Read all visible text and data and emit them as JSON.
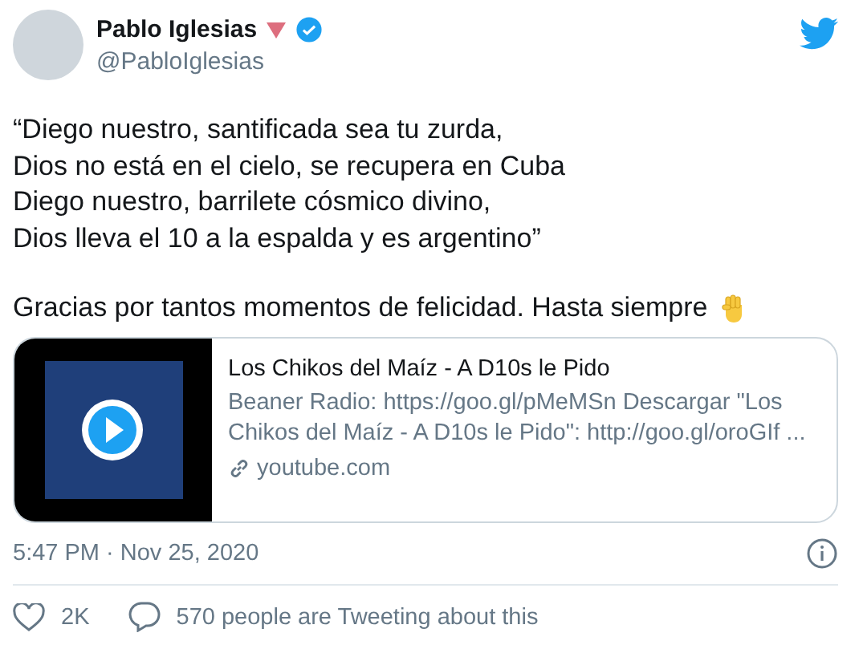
{
  "author": {
    "name": "Pablo Iglesias",
    "handle": "@PabloIglesias",
    "verified": true
  },
  "tweet": {
    "lines": [
      "“Diego nuestro, santificada sea tu zurda,",
      "Dios no está en el cielo, se recupera en Cuba",
      "Diego nuestro, barrilete cósmico divino,",
      "Dios lleva el 10 a la espalda y es argentino”"
    ],
    "closing": "Gracias por tantos momentos de felicidad. Hasta siempre"
  },
  "card": {
    "title": "Los Chikos del Maíz - A D10s le Pido",
    "description": "Beaner Radio: https://goo.gl/pMeMSn Descargar \"Los Chikos del Maíz - A D10s le Pido\": http://goo.gl/oroGIf ...",
    "domain": "youtube.com"
  },
  "timestamp": "5:47 PM · Nov 25, 2020",
  "stats": {
    "likes": "2K",
    "tweeting": "570 people are Tweeting about this"
  }
}
